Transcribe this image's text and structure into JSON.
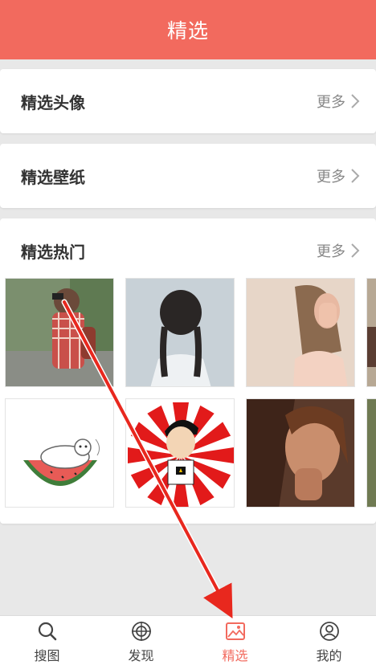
{
  "header": {
    "title": "精选"
  },
  "sections": [
    {
      "title": "精选头像",
      "more": "更多"
    },
    {
      "title": "精选壁纸",
      "more": "更多"
    },
    {
      "title": "精选热门",
      "more": "更多"
    }
  ],
  "hot_images": [
    {
      "name": "girl-with-camera-photo"
    },
    {
      "name": "girl-braids-back-photo"
    },
    {
      "name": "girl-covering-face-photo"
    },
    {
      "name": "cat-in-watermelon-drawing"
    },
    {
      "name": "boy-sunburst-cartoon"
    },
    {
      "name": "woman-portrait-photo"
    }
  ],
  "tabbar": {
    "tabs": [
      {
        "label": "搜图",
        "icon": "search-icon"
      },
      {
        "label": "发现",
        "icon": "target-icon"
      },
      {
        "label": "精选",
        "icon": "image-icon",
        "active": true
      },
      {
        "label": "我的",
        "icon": "user-icon"
      }
    ]
  },
  "colors": {
    "accent": "#f26a5e",
    "annotation_arrow": "#e8281e"
  }
}
